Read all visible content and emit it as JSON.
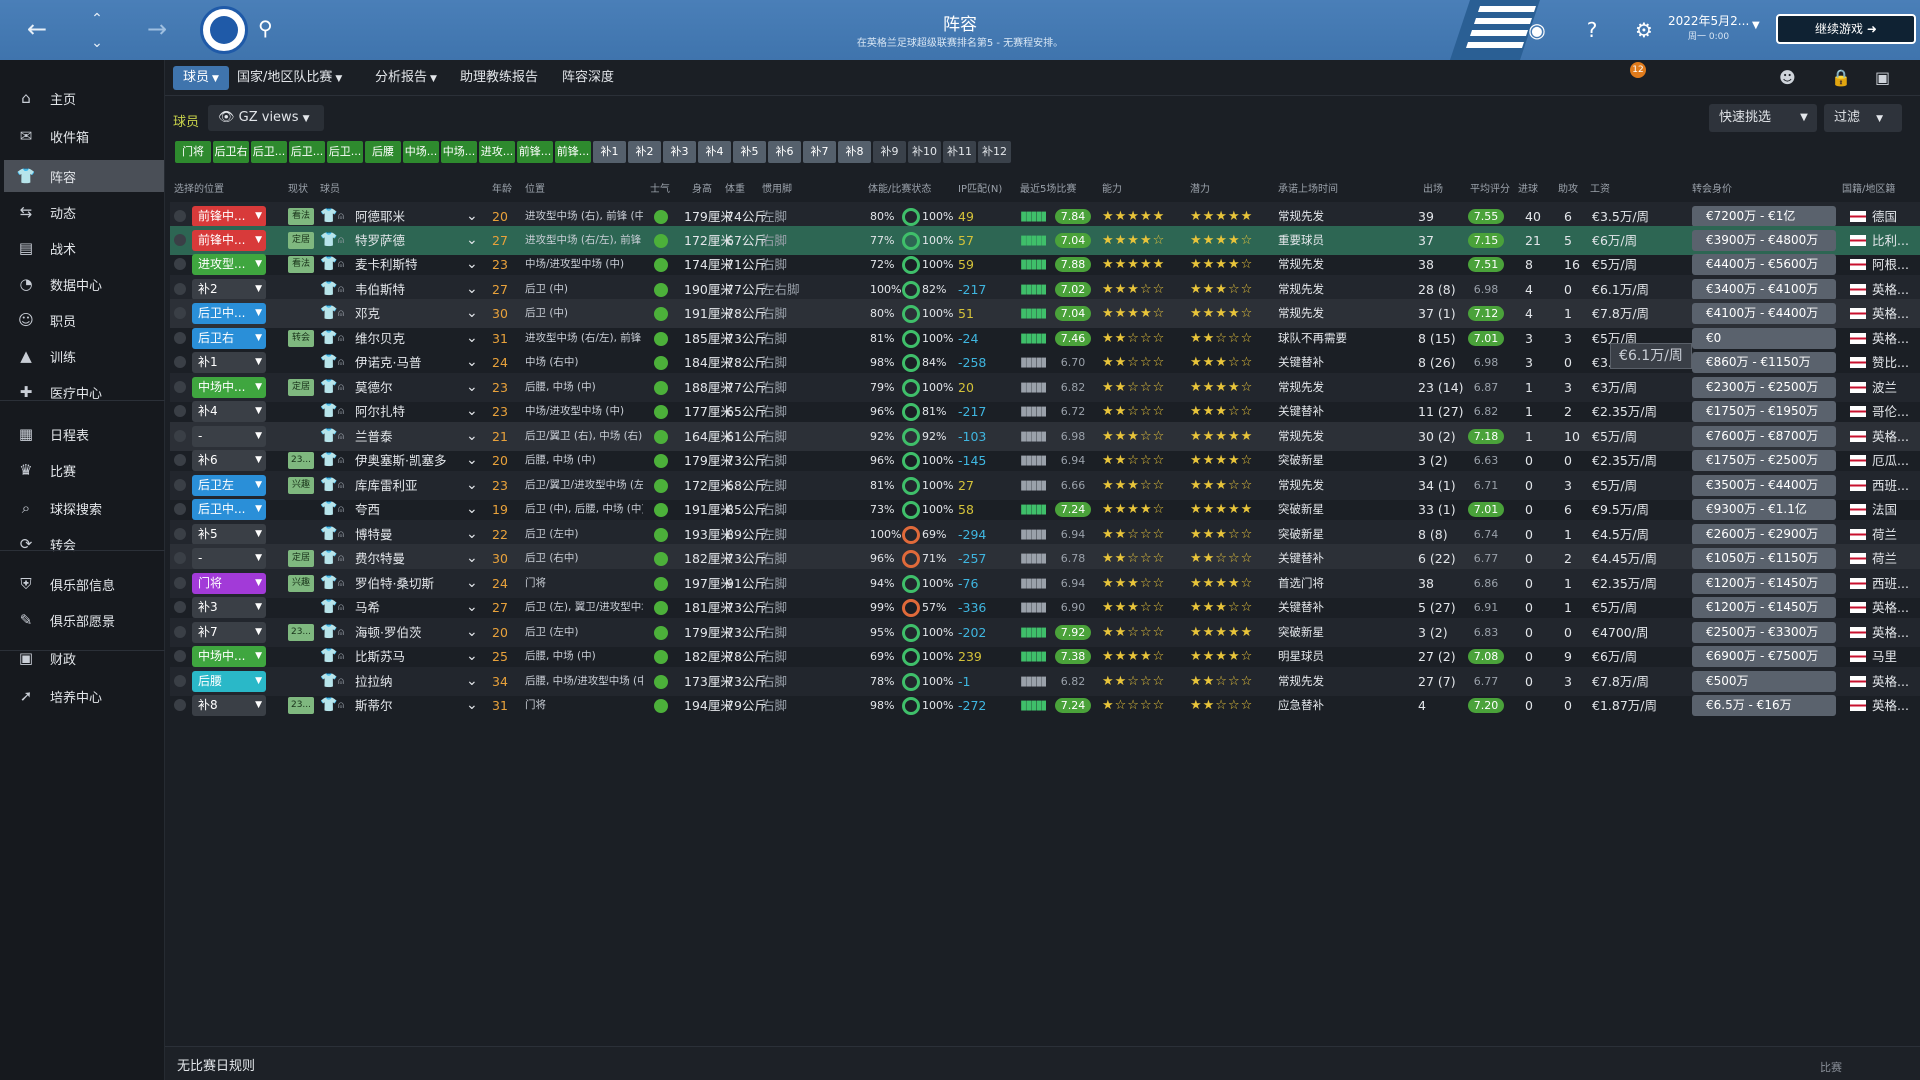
{
  "top": {
    "title": "阵容",
    "subtitle": "在英格兰足球超级联赛排名第5 - 无赛程安排。",
    "date": "2022年5月2...",
    "time": "周一 0:00",
    "continue": "继续游戏"
  },
  "sidebar": {
    "items": [
      {
        "label": "主页",
        "icon": "home-icon"
      },
      {
        "label": "收件箱",
        "icon": "inbox-icon"
      },
      {
        "label": "阵容",
        "icon": "squad-icon"
      },
      {
        "label": "动态",
        "icon": "dynamics-icon"
      },
      {
        "label": "战术",
        "icon": "tactics-icon"
      },
      {
        "label": "数据中心",
        "icon": "data-icon"
      },
      {
        "label": "职员",
        "icon": "staff-icon"
      },
      {
        "label": "训练",
        "icon": "training-icon"
      },
      {
        "label": "医疗中心",
        "icon": "medical-icon"
      },
      {
        "label": "日程表",
        "icon": "calendar-icon"
      },
      {
        "label": "比赛",
        "icon": "trophy-icon"
      },
      {
        "label": "球探搜索",
        "icon": "search-icon"
      },
      {
        "label": "转会",
        "icon": "transfer-icon"
      },
      {
        "label": "俱乐部信息",
        "icon": "shield-icon"
      },
      {
        "label": "俱乐部愿景",
        "icon": "vision-icon"
      },
      {
        "label": "财政",
        "icon": "finance-icon"
      },
      {
        "label": "培养中心",
        "icon": "development-icon"
      }
    ]
  },
  "tabs": [
    "球员",
    "国家/地区队比赛",
    "分析报告",
    "助理教练报告",
    "阵容深度"
  ],
  "toolbar": {
    "players_label": "球员",
    "view": "GZ views",
    "quick_pick": "快速挑选",
    "filter": "过滤",
    "notifications": "12"
  },
  "chips": [
    "门将",
    "后卫右",
    "后卫...",
    "后卫...",
    "后卫...",
    "后腰",
    "中场...",
    "中场...",
    "进攻...",
    "前锋...",
    "前锋...",
    "补1",
    "补2",
    "补3",
    "补4",
    "补5",
    "补6",
    "补7",
    "补8",
    "补9",
    "补10",
    "补11",
    "补12"
  ],
  "columns": [
    "选择的位置",
    "现状",
    "球员",
    "年龄",
    "位置",
    "士气",
    "身高",
    "体重",
    "惯用脚",
    "体能/比赛状态",
    "IP匹配(N)",
    "最近5场比赛",
    "能力",
    "潜力",
    "承诺上场时间",
    "出场",
    "平均评分",
    "进球",
    "助攻",
    "工资",
    "转会身价",
    "国籍/地区籍"
  ],
  "players": [
    {
      "sel": "前锋中...",
      "selc": "#d83a3a",
      "status": "看法",
      "name": "阿德耶米",
      "age": "20",
      "pos": "进攻型中场 (右), 前锋 (中)",
      "h": "179厘米",
      "w": "74公斤",
      "foot": "左脚",
      "fit": "80%",
      "mf": "100%",
      "ip": "49",
      "ipc": "plus",
      "form": "7.84",
      "fg": true,
      "ca": "★★★★★",
      "pa": "★★★★★",
      "role": "常规先发",
      "apps": "39",
      "rating": "7.55",
      "rg": true,
      "goals": "40",
      "assists": "6",
      "wage": "€3.5万/周",
      "value": "€7200万 - €1亿",
      "nat": "德国"
    },
    {
      "sel": "前锋中...",
      "selc": "#d83a3a",
      "status": "定居",
      "name": "特罗萨德",
      "age": "27",
      "pos": "进攻型中场 (右/左), 前锋",
      "h": "172厘米",
      "w": "67公斤",
      "foot": "右脚",
      "fit": "77%",
      "mf": "100%",
      "ip": "57",
      "ipc": "plus",
      "form": "7.04",
      "fg": true,
      "ca": "★★★★☆",
      "pa": "★★★★☆",
      "role": "重要球员",
      "apps": "37",
      "rating": "7.15",
      "rg": true,
      "goals": "21",
      "assists": "5",
      "wage": "€6万/周",
      "value": "€3900万 - €4800万",
      "nat": "比利..."
    },
    {
      "sel": "进攻型...",
      "selc": "#3fa63f",
      "status": "看法",
      "name": "麦卡利斯特",
      "age": "23",
      "pos": "中场/进攻型中场 (中)",
      "h": "174厘米",
      "w": "71公斤",
      "foot": "右脚",
      "fit": "72%",
      "mf": "100%",
      "ip": "59",
      "ipc": "plus",
      "form": "7.88",
      "fg": true,
      "ca": "★★★★★",
      "pa": "★★★★☆",
      "role": "常规先发",
      "apps": "38",
      "rating": "7.51",
      "rg": true,
      "goals": "8",
      "assists": "16",
      "wage": "€5万/周",
      "value": "€4400万 - €5600万",
      "nat": "阿根..."
    },
    {
      "sel": "补2",
      "selc": "#3a3f46",
      "status": "",
      "name": "韦伯斯特",
      "age": "27",
      "pos": "后卫 (中)",
      "h": "190厘米",
      "w": "77公斤",
      "foot": "左右脚",
      "fit": "100%",
      "mf": "82%",
      "ip": "-217",
      "ipc": "minus",
      "form": "7.02",
      "fg": true,
      "ca": "★★★☆☆",
      "pa": "★★★☆☆",
      "role": "常规先发",
      "apps": "28 (8)",
      "rating": "6.98",
      "rg": false,
      "goals": "4",
      "assists": "0",
      "wage": "€6.1万/周",
      "value": "€3400万 - €4100万",
      "nat": "英格..."
    },
    {
      "sel": "后卫中...",
      "selc": "#2a8fd8",
      "status": "",
      "name": "邓克",
      "age": "30",
      "pos": "后卫 (中)",
      "h": "191厘米",
      "w": "78公斤",
      "foot": "右脚",
      "fit": "80%",
      "mf": "100%",
      "ip": "51",
      "ipc": "plus",
      "form": "7.04",
      "fg": true,
      "ca": "★★★★☆",
      "pa": "★★★★☆",
      "role": "常规先发",
      "apps": "37 (1)",
      "rating": "7.12",
      "rg": true,
      "goals": "4",
      "assists": "1",
      "wage": "€7.8万/周",
      "value": "€4100万 - €4400万",
      "nat": "英格..."
    },
    {
      "sel": "后卫右",
      "selc": "#2a8fd8",
      "status": "转会",
      "name": "维尔贝克",
      "age": "31",
      "pos": "进攻型中场 (右/左), 前锋",
      "h": "185厘米",
      "w": "73公斤",
      "foot": "右脚",
      "fit": "81%",
      "mf": "100%",
      "ip": "-24",
      "ipc": "minus",
      "form": "7.46",
      "fg": true,
      "ca": "★★☆☆☆",
      "pa": "★★☆☆☆",
      "role": "球队不再需要",
      "apps": "8 (15)",
      "rating": "7.01",
      "rg": true,
      "goals": "3",
      "assists": "3",
      "wage": "€5万/周",
      "value": "€0",
      "nat": "英格..."
    },
    {
      "sel": "补1",
      "selc": "#3a3f46",
      "status": "",
      "name": "伊诺克·马普",
      "age": "24",
      "pos": "中场 (右中)",
      "h": "184厘米",
      "w": "78公斤",
      "foot": "右脚",
      "fit": "98%",
      "mf": "84%",
      "ip": "-258",
      "ipc": "minus",
      "form": "6.70",
      "fg": false,
      "ca": "★★☆☆☆",
      "pa": "★★★☆☆",
      "role": "关键替补",
      "apps": "8 (26)",
      "rating": "6.98",
      "rg": false,
      "goals": "3",
      "assists": "0",
      "wage": "€3.5万/周",
      "value": "€860万 - €1150万",
      "nat": "赞比..."
    },
    {
      "sel": "中场中...",
      "selc": "#3fa63f",
      "status": "定居",
      "name": "莫德尔",
      "age": "23",
      "pos": "后腰, 中场 (中)",
      "h": "188厘米",
      "w": "77公斤",
      "foot": "右脚",
      "fit": "79%",
      "mf": "100%",
      "ip": "20",
      "ipc": "plus",
      "form": "6.82",
      "fg": false,
      "ca": "★★☆☆☆",
      "pa": "★★★★☆",
      "role": "常规先发",
      "apps": "23 (14)",
      "rating": "6.87",
      "rg": false,
      "goals": "1",
      "assists": "3",
      "wage": "€3万/周",
      "value": "€2300万 - €2500万",
      "nat": "波兰"
    },
    {
      "sel": "补4",
      "selc": "#3a3f46",
      "status": "",
      "name": "阿尔扎特",
      "age": "23",
      "pos": "中场/进攻型中场 (中)",
      "h": "177厘米",
      "w": "65公斤",
      "foot": "右脚",
      "fit": "96%",
      "mf": "81%",
      "ip": "-217",
      "ipc": "minus",
      "form": "6.72",
      "fg": false,
      "ca": "★★☆☆☆",
      "pa": "★★★☆☆",
      "role": "关键替补",
      "apps": "11 (27)",
      "rating": "6.82",
      "rg": false,
      "goals": "1",
      "assists": "2",
      "wage": "€2.35万/周",
      "value": "€1750万 - €1950万",
      "nat": "哥伦..."
    },
    {
      "sel": "-",
      "selc": "#3a3f46",
      "status": "",
      "name": "兰普泰",
      "age": "21",
      "pos": "后卫/翼卫 (右), 中场 (右)",
      "h": "164厘米",
      "w": "61公斤",
      "foot": "右脚",
      "fit": "92%",
      "mf": "92%",
      "ip": "-103",
      "ipc": "minus",
      "form": "6.98",
      "fg": false,
      "ca": "★★★☆☆",
      "pa": "★★★★★",
      "role": "常规先发",
      "apps": "30 (2)",
      "rating": "7.18",
      "rg": true,
      "goals": "1",
      "assists": "10",
      "wage": "€5万/周",
      "value": "€7600万 - €8700万",
      "nat": "英格..."
    },
    {
      "sel": "补6",
      "selc": "#3a3f46",
      "status": "23...",
      "name": "伊奥塞斯·凯塞多",
      "age": "20",
      "pos": "后腰, 中场 (中)",
      "h": "179厘米",
      "w": "73公斤",
      "foot": "右脚",
      "fit": "96%",
      "mf": "100%",
      "ip": "-145",
      "ipc": "minus",
      "form": "6.94",
      "fg": false,
      "ca": "★★☆☆☆",
      "pa": "★★★★☆",
      "role": "突破新星",
      "apps": "3 (2)",
      "rating": "6.63",
      "rg": false,
      "goals": "0",
      "assists": "0",
      "wage": "€2.35万/周",
      "value": "€1750万 - €2500万",
      "nat": "厄瓜..."
    },
    {
      "sel": "后卫左",
      "selc": "#2a8fd8",
      "status": "兴趣",
      "name": "库库雷利亚",
      "age": "23",
      "pos": "后卫/翼卫/进攻型中场 (左)",
      "h": "172厘米",
      "w": "68公斤",
      "foot": "左脚",
      "fit": "81%",
      "mf": "100%",
      "ip": "27",
      "ipc": "plus",
      "form": "6.66",
      "fg": false,
      "ca": "★★★☆☆",
      "pa": "★★★☆☆",
      "role": "常规先发",
      "apps": "34 (1)",
      "rating": "6.71",
      "rg": false,
      "goals": "0",
      "assists": "3",
      "wage": "€5万/周",
      "value": "€3500万 - €4400万",
      "nat": "西班..."
    },
    {
      "sel": "后卫中...",
      "selc": "#2a8fd8",
      "status": "",
      "name": "夸西",
      "age": "19",
      "pos": "后卫 (中), 后腰, 中场 (中)",
      "h": "191厘米",
      "w": "85公斤",
      "foot": "右脚",
      "fit": "73%",
      "mf": "100%",
      "ip": "58",
      "ipc": "plus",
      "form": "7.24",
      "fg": true,
      "ca": "★★★★☆",
      "pa": "★★★★★",
      "role": "突破新星",
      "apps": "33 (1)",
      "rating": "7.01",
      "rg": true,
      "goals": "0",
      "assists": "6",
      "wage": "€9.5万/周",
      "value": "€9300万 - €1.1亿",
      "nat": "法国"
    },
    {
      "sel": "补5",
      "selc": "#3a3f46",
      "status": "",
      "name": "博特曼",
      "age": "22",
      "pos": "后卫 (左中)",
      "h": "193厘米",
      "w": "89公斤",
      "foot": "左脚",
      "fit": "100%",
      "mf": "69%",
      "ip": "-294",
      "ipc": "minus",
      "form": "6.94",
      "fg": false,
      "ca": "★★☆☆☆",
      "pa": "★★★☆☆",
      "role": "突破新星",
      "apps": "8 (8)",
      "rating": "6.74",
      "rg": false,
      "goals": "0",
      "assists": "1",
      "wage": "€4.5万/周",
      "value": "€2600万 - €2900万",
      "nat": "荷兰"
    },
    {
      "sel": "-",
      "selc": "#3a3f46",
      "status": "定居",
      "name": "费尔特曼",
      "age": "30",
      "pos": "后卫 (右中)",
      "h": "182厘米",
      "w": "73公斤",
      "foot": "右脚",
      "fit": "96%",
      "mf": "71%",
      "ip": "-257",
      "ipc": "minus",
      "form": "6.78",
      "fg": false,
      "ca": "★★☆☆☆",
      "pa": "★★☆☆☆",
      "role": "关键替补",
      "apps": "6 (22)",
      "rating": "6.77",
      "rg": false,
      "goals": "0",
      "assists": "2",
      "wage": "€4.45万/周",
      "value": "€1050万 - €1150万",
      "nat": "荷兰"
    },
    {
      "sel": "门将",
      "selc": "#a23ad8",
      "status": "兴趣",
      "name": "罗伯特·桑切斯",
      "age": "24",
      "pos": "门将",
      "h": "197厘米",
      "w": "91公斤",
      "foot": "右脚",
      "fit": "94%",
      "mf": "100%",
      "ip": "-76",
      "ipc": "minus",
      "form": "6.94",
      "fg": false,
      "ca": "★★★☆☆",
      "pa": "★★★★☆",
      "role": "首选门将",
      "apps": "38",
      "rating": "6.86",
      "rg": false,
      "goals": "0",
      "assists": "1",
      "wage": "€2.35万/周",
      "value": "€1200万 - €1450万",
      "nat": "西班..."
    },
    {
      "sel": "补3",
      "selc": "#3a3f46",
      "status": "",
      "name": "马希",
      "age": "27",
      "pos": "后卫 (左), 翼卫/进攻型中场",
      "h": "181厘米",
      "w": "73公斤",
      "foot": "右脚",
      "fit": "99%",
      "mf": "57%",
      "ip": "-336",
      "ipc": "minus",
      "form": "6.90",
      "fg": false,
      "ca": "★★★☆☆",
      "pa": "★★★☆☆",
      "role": "关键替补",
      "apps": "5 (27)",
      "rating": "6.91",
      "rg": false,
      "goals": "0",
      "assists": "1",
      "wage": "€5万/周",
      "value": "€1200万 - €1450万",
      "nat": "英格..."
    },
    {
      "sel": "补7",
      "selc": "#3a3f46",
      "status": "23...",
      "name": "海顿·罗伯茨",
      "age": "20",
      "pos": "后卫 (左中)",
      "h": "179厘米",
      "w": "73公斤",
      "foot": "右脚",
      "fit": "95%",
      "mf": "100%",
      "ip": "-202",
      "ipc": "minus",
      "form": "7.92",
      "fg": true,
      "ca": "★★☆☆☆",
      "pa": "★★★★★",
      "role": "突破新星",
      "apps": "3 (2)",
      "rating": "6.83",
      "rg": false,
      "goals": "0",
      "assists": "0",
      "wage": "€4700/周",
      "value": "€2500万 - €3300万",
      "nat": "英格..."
    },
    {
      "sel": "中场中...",
      "selc": "#3fa63f",
      "status": "",
      "name": "比斯苏马",
      "age": "25",
      "pos": "后腰, 中场 (中)",
      "h": "182厘米",
      "w": "78公斤",
      "foot": "右脚",
      "fit": "69%",
      "mf": "100%",
      "ip": "239",
      "ipc": "plus",
      "form": "7.38",
      "fg": true,
      "ca": "★★★★☆",
      "pa": "★★★★☆",
      "role": "明星球员",
      "apps": "27 (2)",
      "rating": "7.08",
      "rg": true,
      "goals": "0",
      "assists": "9",
      "wage": "€6万/周",
      "value": "€6900万 - €7500万",
      "nat": "马里"
    },
    {
      "sel": "后腰",
      "selc": "#2ab8c8",
      "status": "",
      "name": "拉拉纳",
      "age": "34",
      "pos": "后腰, 中场/进攻型中场 (中)",
      "h": "173厘米",
      "w": "73公斤",
      "foot": "右脚",
      "fit": "78%",
      "mf": "100%",
      "ip": "-1",
      "ipc": "minus",
      "form": "6.82",
      "fg": false,
      "ca": "★★☆☆☆",
      "pa": "★★☆☆☆",
      "role": "常规先发",
      "apps": "27 (7)",
      "rating": "6.77",
      "rg": false,
      "goals": "0",
      "assists": "3",
      "wage": "€7.8万/周",
      "value": "€500万",
      "nat": "英格..."
    },
    {
      "sel": "补8",
      "selc": "#3a3f46",
      "status": "23...",
      "name": "斯蒂尔",
      "age": "31",
      "pos": "门将",
      "h": "194厘米",
      "w": "79公斤",
      "foot": "右脚",
      "fit": "98%",
      "mf": "100%",
      "ip": "-272",
      "ipc": "minus",
      "form": "7.24",
      "fg": true,
      "ca": "★☆☆☆☆",
      "pa": "★★☆☆☆",
      "role": "应急替补",
      "apps": "4",
      "rating": "7.20",
      "rg": true,
      "goals": "0",
      "assists": "0",
      "wage": "€1.87万/周",
      "value": "€6.5万 - €16万",
      "nat": "英格..."
    }
  ],
  "tooltip": "€6.1万/周",
  "footer": "无比赛日规则",
  "footer_right": "比赛"
}
